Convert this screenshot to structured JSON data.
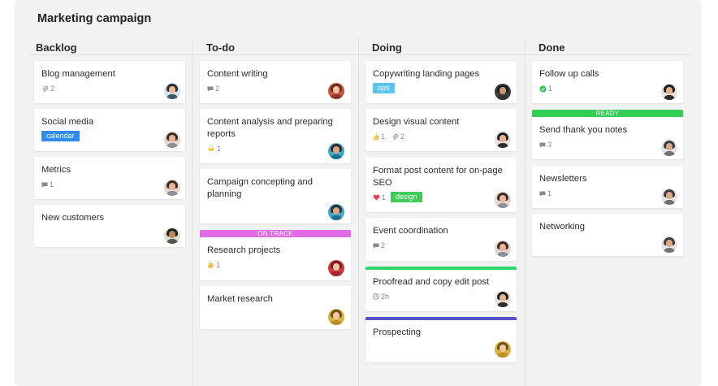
{
  "board": {
    "title": "Marketing campaign"
  },
  "columns": [
    {
      "title": "Backlog",
      "cards": [
        {
          "title": "Blog management",
          "attachments": "2"
        },
        {
          "title": "Social media",
          "tag": "calendar",
          "tag_color": "#2d8ceb"
        },
        {
          "title": "Metrics",
          "comments": "1"
        },
        {
          "title": "New customers"
        }
      ]
    },
    {
      "title": "To-do",
      "cards": [
        {
          "title": "Content writing",
          "comments": "2"
        },
        {
          "title_line1": "Content analysis and preparing",
          "title_line2": "reports",
          "reaction": "1",
          "reaction_icon": "clap-icon"
        },
        {
          "title_line1": "Campaign concepting and",
          "title_line2": "planning"
        },
        {
          "banner": "ON TRACK",
          "banner_color": "#e26be8",
          "title": "Research projects",
          "reaction": "1",
          "reaction_icon": "wave-hand-icon"
        },
        {
          "title": "Market research"
        }
      ]
    },
    {
      "title": "Doing",
      "cards": [
        {
          "title": "Copywriting landing pages",
          "tag": "ops",
          "tag_color": "#5bc4ec"
        },
        {
          "title": "Design visual content",
          "likes": "1",
          "attachments": "2"
        },
        {
          "title_line1": "Format post content for on-page",
          "title_line2": "SEO",
          "hearts": "1",
          "tag": "design",
          "tag_color": "#3ecb5a"
        },
        {
          "title": "Event coordination",
          "comments": "2"
        },
        {
          "stripe_color": "#2fd46b",
          "title": "Proofread and copy edit post",
          "time": "2h"
        },
        {
          "stripe_color": "#5553c9",
          "title": "Prospecting"
        }
      ]
    },
    {
      "title": "Done",
      "cards": [
        {
          "title": "Follow up calls",
          "checks": "1"
        },
        {
          "banner": "READY",
          "banner_color": "#33cf55",
          "title": "Send thank you notes",
          "comments": "3"
        },
        {
          "title": "Newsletters",
          "comments": "1"
        },
        {
          "title": "Networking"
        }
      ]
    }
  ],
  "colors": {
    "board_bg": "#f2f2f2",
    "card_bg": "#ffffff",
    "heart": "#e2445c",
    "check": "#30c452",
    "icon_gray": "#8a8a8a"
  }
}
